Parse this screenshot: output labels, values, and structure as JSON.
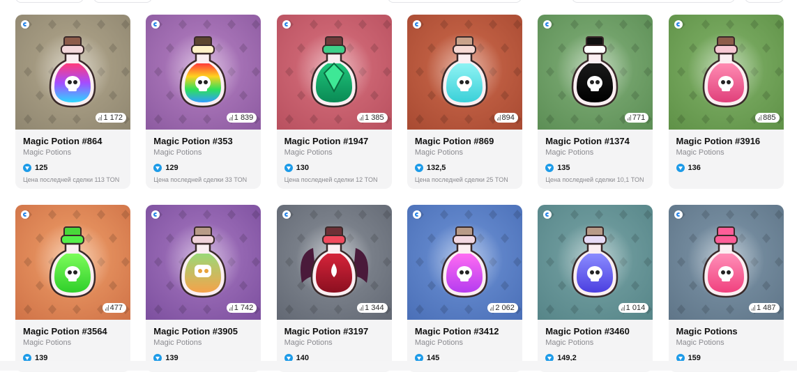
{
  "colors": {
    "accent": "#1f7fe6",
    "ton": "#1d9be8"
  },
  "cards": [
    {
      "title": "Magic Potion #864",
      "collection": "Magic Potions",
      "price": "125",
      "count": "1 172",
      "last_sale": "Цена последней сделки 113 TON",
      "bg1": "#b4a98e",
      "bg2": "#8f8670",
      "bottle": "potion-rainbow"
    },
    {
      "title": "Magic Potion #353",
      "collection": "Magic Potions",
      "price": "129",
      "count": "1 839",
      "last_sale": "Цена последней сделки 33 TON",
      "bg1": "#b782c4",
      "bg2": "#8c5aa0",
      "bottle": "potion-spectrum"
    },
    {
      "title": "Magic Potion #1947",
      "collection": "Magic Potions",
      "price": "130",
      "count": "1 385",
      "last_sale": "Цена последней сделки 12 TON",
      "bg1": "#d9727f",
      "bg2": "#b8505f",
      "bottle": "potion-green-gem"
    },
    {
      "title": "Magic Potion #869",
      "collection": "Magic Potions",
      "price": "132,5",
      "count": "894",
      "last_sale": "Цена последней сделки 25 TON",
      "bg1": "#cd6a4c",
      "bg2": "#a84a32",
      "bottle": "potion-cyan"
    },
    {
      "title": "Magic Potion #1374",
      "collection": "Magic Potions",
      "price": "135",
      "count": "771",
      "last_sale": "Цена последней сделки 10,1 TON",
      "bg1": "#82b07a",
      "bg2": "#5c8e55",
      "bottle": "potion-black"
    },
    {
      "title": "Magic Potion #3916",
      "collection": "Magic Potions",
      "price": "136",
      "count": "885",
      "last_sale": "",
      "bg1": "#82b36a",
      "bg2": "#5f9147",
      "bottle": "potion-pink"
    },
    {
      "title": "Magic Potion #3564",
      "collection": "Magic Potions",
      "price": "139",
      "count": "477",
      "last_sale": "",
      "bg1": "#f0a06a",
      "bg2": "#cf7247",
      "bottle": "potion-lime"
    },
    {
      "title": "Magic Potion #3905",
      "collection": "Magic Potions",
      "price": "139",
      "count": "1 742",
      "last_sale": "",
      "bg1": "#a879c2",
      "bg2": "#7c4f9e",
      "bottle": "potion-green-orange"
    },
    {
      "title": "Magic Potion #3197",
      "collection": "Magic Potions",
      "price": "140",
      "count": "1 344",
      "last_sale": "",
      "bg1": "#8a9099",
      "bg2": "#626873",
      "bottle": "potion-red-wings"
    },
    {
      "title": "Magic Potion #3412",
      "collection": "Magic Potions",
      "price": "145",
      "count": "2 062",
      "last_sale": "",
      "bg1": "#6e93d6",
      "bg2": "#4a6fb7",
      "bottle": "potion-magenta"
    },
    {
      "title": "Magic Potion #3460",
      "collection": "Magic Potions",
      "price": "149,2",
      "count": "1 014",
      "last_sale": "",
      "bg1": "#78a4a6",
      "bg2": "#568588",
      "bottle": "potion-violet"
    },
    {
      "title": "Magic Potions",
      "collection": "Magic Potions",
      "price": "159",
      "count": "1 487",
      "last_sale": "",
      "bg1": "#7f97aa",
      "bg2": "#5f7588",
      "bottle": "potion-hot-pink"
    }
  ]
}
